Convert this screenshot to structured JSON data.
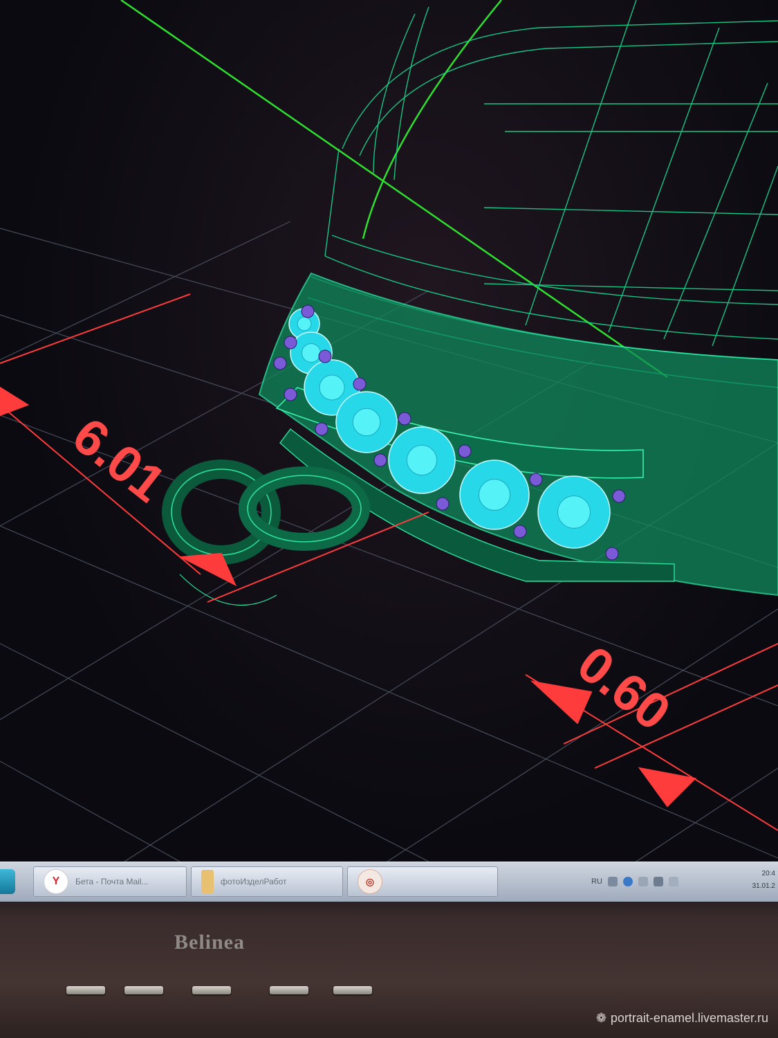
{
  "viewport": {
    "dimensions": [
      {
        "label": "6.01"
      },
      {
        "label": "0.60"
      }
    ],
    "colors": {
      "background": "#0b0a10",
      "grid": "#4a5060",
      "dimension": "#ff3c3c",
      "wireframe": "#19e39a",
      "axis": "#2fe02f",
      "gem": "#2fe9f2",
      "prong": "#7a5cd6"
    }
  },
  "taskbar": {
    "items": [
      {
        "icon": "start-orb-icon",
        "label": ""
      },
      {
        "icon": "yandex-browser-icon",
        "label": "Бета - Почта Mail..."
      },
      {
        "icon": "folder-icon",
        "label": "фотоИзделРабот"
      },
      {
        "icon": "app-logo-icon",
        "label": ""
      }
    ],
    "tray": {
      "language": "RU",
      "time": "20:4",
      "date": "31.01.2"
    }
  },
  "monitor": {
    "brand": "Belinea"
  },
  "watermark": {
    "text": "portrait-enamel.livemaster.ru"
  }
}
